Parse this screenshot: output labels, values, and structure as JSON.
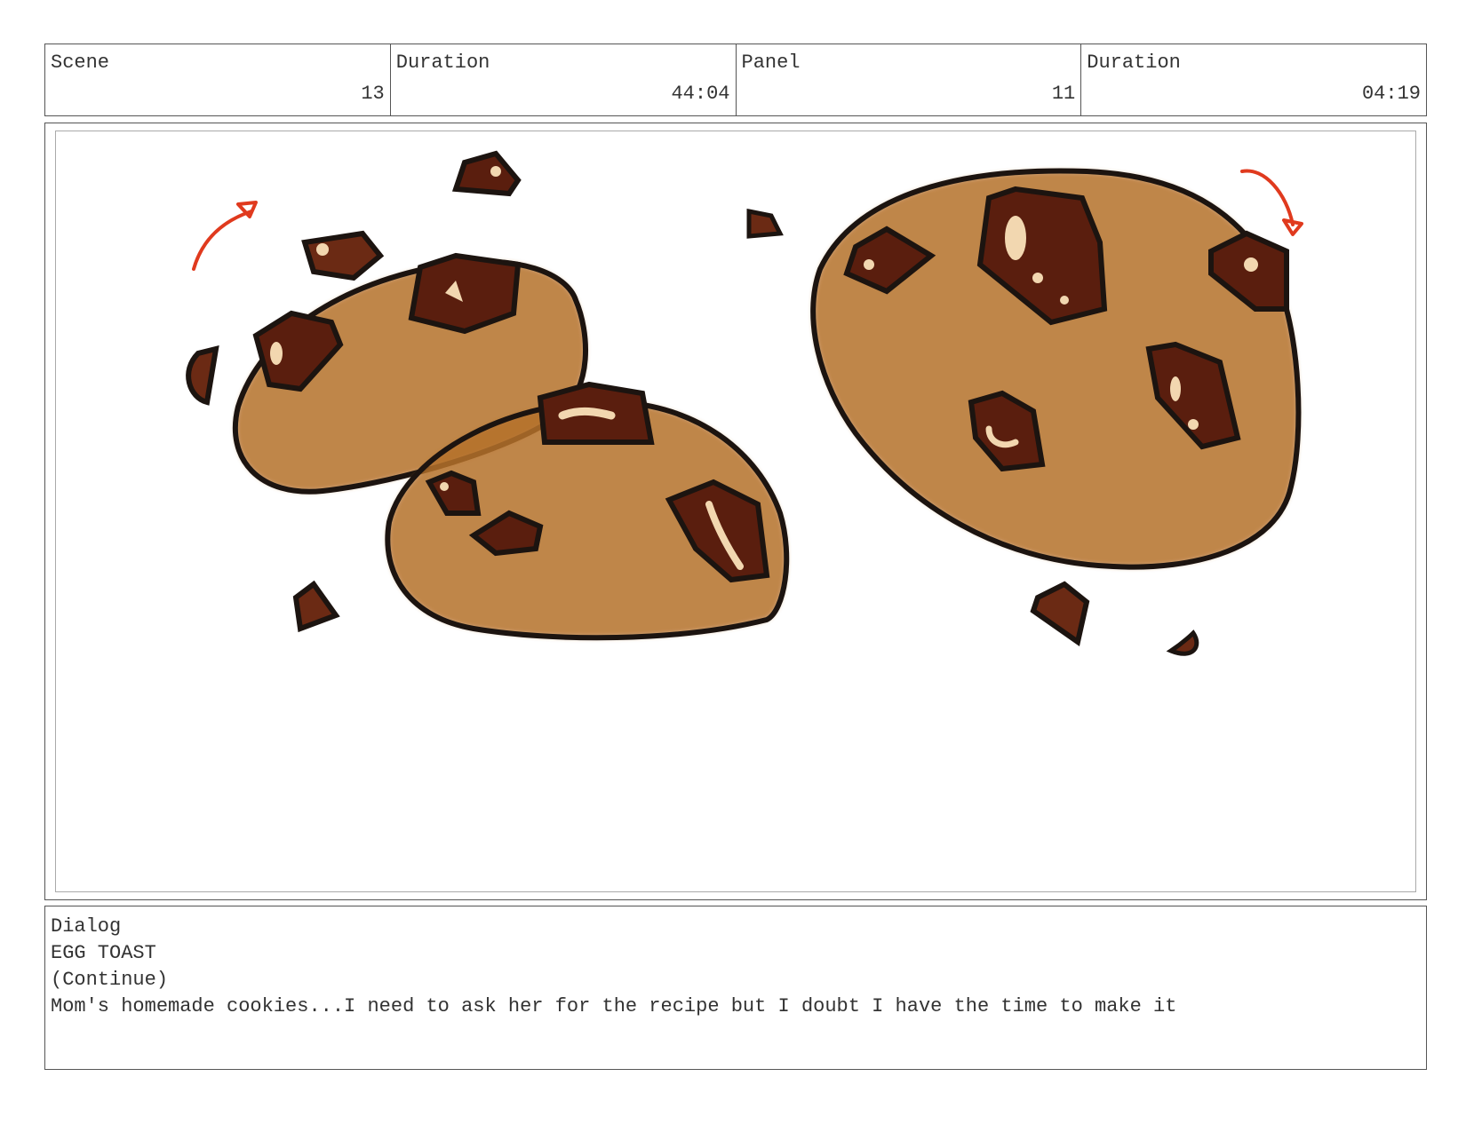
{
  "header": {
    "scene_label": "Scene",
    "scene_value": "13",
    "scene_duration_label": "Duration",
    "scene_duration_value": "44:04",
    "panel_label": "Panel",
    "panel_value": "11",
    "panel_duration_label": "Duration",
    "panel_duration_value": "04:19"
  },
  "panel": {
    "subject": "three chocolate chip cookies sketch",
    "colors": {
      "dough": "#b5712a",
      "chip": "#5a1e0e",
      "outline": "#1c1410",
      "arrow": "#e03a1e"
    }
  },
  "dialog": {
    "label": "Dialog",
    "character": "EGG TOAST",
    "parenthetical": "(Continue)",
    "line": "Mom's homemade cookies...I need to ask her for the recipe but I doubt I have the time to make it"
  }
}
